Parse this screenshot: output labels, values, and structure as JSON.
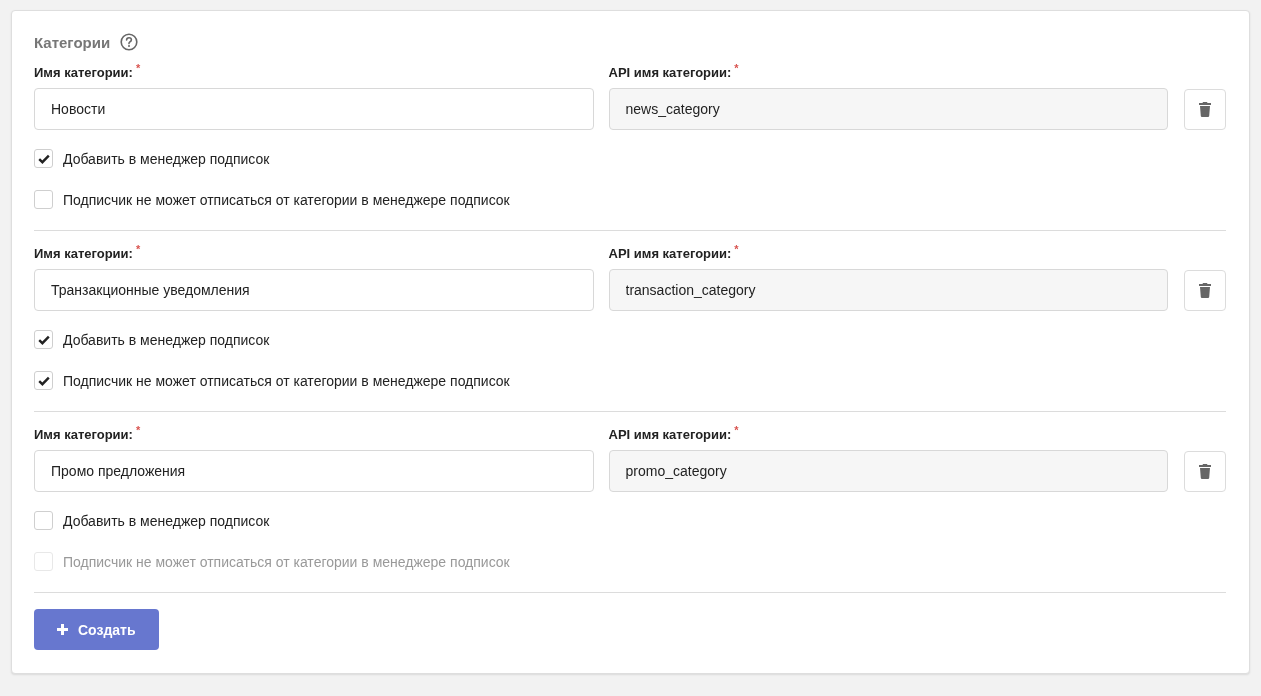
{
  "section": {
    "title": "Категории"
  },
  "categories": [
    {
      "name_label": "Имя категории:",
      "name_mark": "*",
      "name": "Новости",
      "api_label": "API имя категории:",
      "api_mark": "*",
      "api_name": "news_category",
      "options": [
        {
          "label": "Добавить в менеджер подписок",
          "checked": true,
          "disabled": false
        },
        {
          "label": "Подписчик не может отписаться от категории в менеджере подписок",
          "checked": false,
          "disabled": false
        }
      ]
    },
    {
      "name_label": "Имя категории:",
      "name_mark": "*",
      "name": "Транзакционные уведомления",
      "api_label": "API имя категории:",
      "api_mark": "*",
      "api_name": "transaction_category",
      "options": [
        {
          "label": "Добавить в менеджер подписок",
          "checked": true,
          "disabled": false
        },
        {
          "label": "Подписчик не может отписаться от категории в менеджере подписок",
          "checked": true,
          "disabled": false
        }
      ]
    },
    {
      "name_label": "Имя категории:",
      "name_mark": "*",
      "name": "Промо предложения",
      "api_label": "API имя категории:",
      "api_mark": "*",
      "api_name": "promo_category",
      "options": [
        {
          "label": "Добавить в менеджер подписок",
          "checked": false,
          "disabled": false
        },
        {
          "label": "Подписчик не может отписаться от категории в менеджере подписок",
          "checked": false,
          "disabled": true
        }
      ]
    }
  ],
  "create_button": {
    "label": "Создать"
  }
}
